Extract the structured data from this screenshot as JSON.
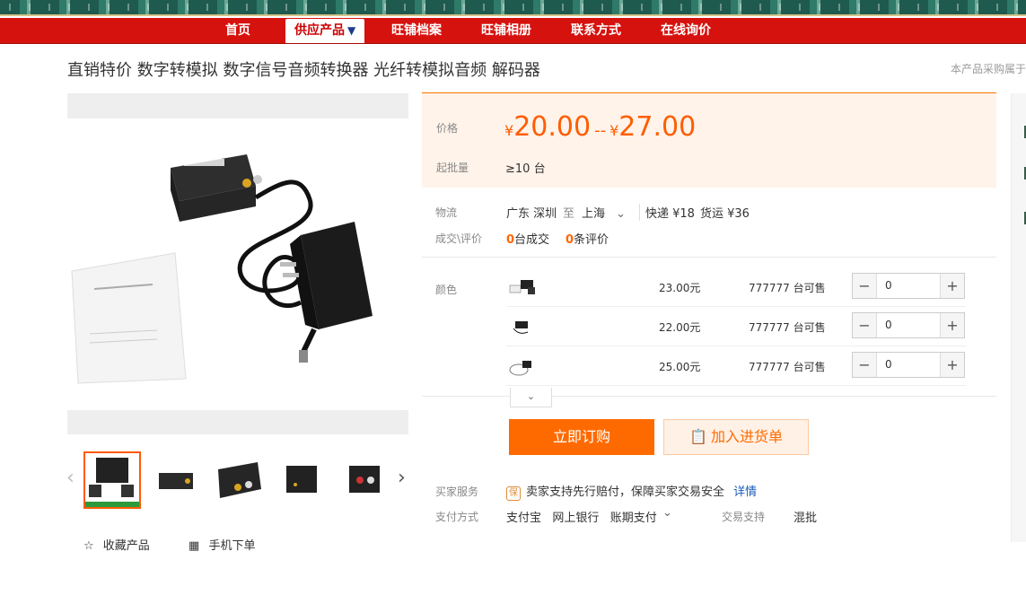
{
  "nav": {
    "items": [
      {
        "label": "首页"
      },
      {
        "label": "供应产品"
      },
      {
        "label": "旺铺档案"
      },
      {
        "label": "旺铺相册"
      },
      {
        "label": "联系方式"
      },
      {
        "label": "在线询价"
      }
    ],
    "active_caret": "▼"
  },
  "product": {
    "title": "直销特价 数字转模拟 数字信号音频转换器 光纤转模拟音频 解码器",
    "side_note": "本产品采购属于"
  },
  "gallery": {
    "prev_icon": "‹",
    "next_icon": "›",
    "favorite_label": "收藏产品",
    "mobile_label": "手机下单"
  },
  "pricing": {
    "price_label": "价格",
    "currency": "¥",
    "price_low": "20.00",
    "separator": "--",
    "price_high": "27.00",
    "moq_label": "起批量",
    "moq_value": "≥10 台"
  },
  "logistics": {
    "label": "物流",
    "from": "广东 深圳",
    "to_word": "至",
    "dest": "上海",
    "express": "快递 ¥18",
    "freight": "货运 ¥36"
  },
  "deals": {
    "label": "成交\\评价",
    "deal_count": "0",
    "deal_suffix": "台成交",
    "review_count": "0",
    "review_suffix": "条评价"
  },
  "sku": {
    "label": "颜色",
    "rows": [
      {
        "price": "23.00元",
        "stock": "777777 台可售",
        "qty": "0"
      },
      {
        "price": "22.00元",
        "stock": "777777 台可售",
        "qty": "0"
      },
      {
        "price": "25.00元",
        "stock": "777777 台可售",
        "qty": "0"
      }
    ],
    "minus": "−",
    "plus": "+"
  },
  "actions": {
    "buy_label": "立即订购",
    "cart_label": "加入进货单"
  },
  "service": {
    "label": "买家服务",
    "badge": "保",
    "text": "卖家支持先行赔付，保障买家交易安全",
    "detail_link": "详情"
  },
  "payment": {
    "label": "支付方式",
    "methods": "支付宝   网上银行   账期支付",
    "trade_label": "交易支持",
    "trade_value": "混批"
  },
  "colors": {
    "nav_red": "#d6120e",
    "accent_orange": "#ff6a00"
  }
}
